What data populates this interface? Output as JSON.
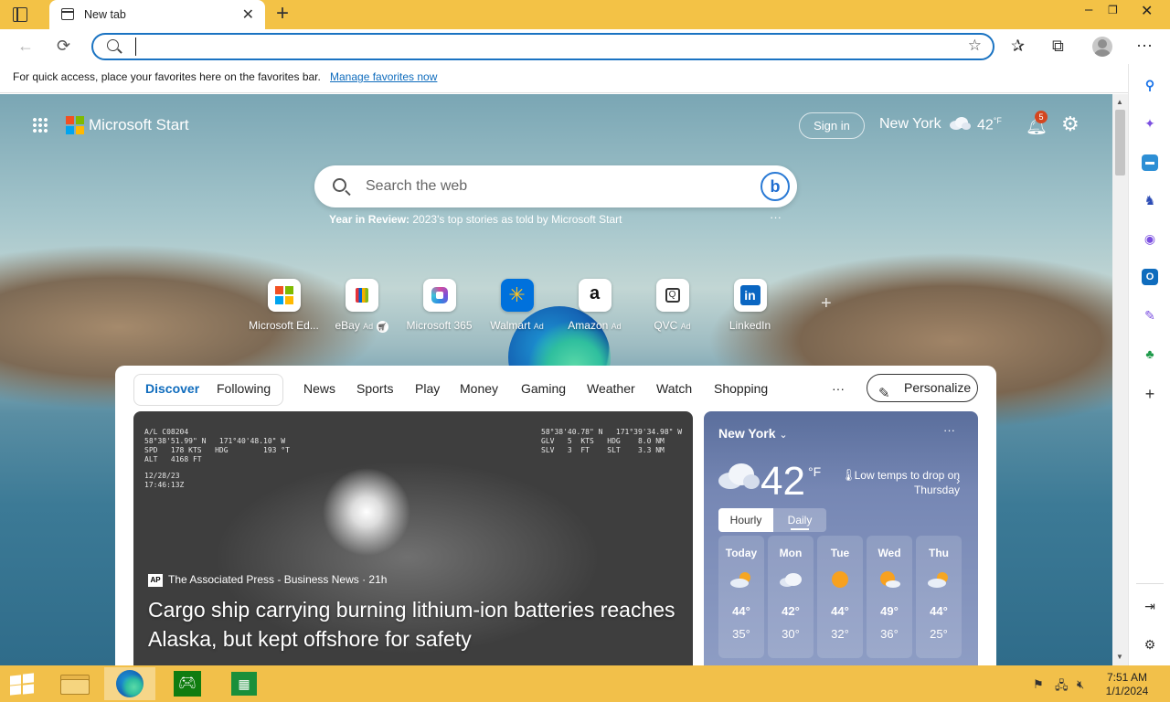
{
  "browser": {
    "tab_title": "New tab",
    "tab_close_icon": "close-icon",
    "new_tab_icon": "plus-icon",
    "window_controls": [
      "minimize-icon",
      "restore-icon",
      "close-icon"
    ],
    "address": {
      "value": "",
      "placeholder": ""
    },
    "toolbar_icons": [
      "back-icon",
      "refresh-icon",
      "add-favorite-icon",
      "favorites-icon",
      "collections-icon",
      "profile-avatar",
      "more-icon"
    ],
    "favorites_bar": {
      "message": "For quick access, place your favorites here on the favorites bar.",
      "link": "Manage favorites now"
    }
  },
  "header": {
    "brand": "Microsoft Start",
    "signin": "Sign in",
    "city": "New York",
    "temp": "42",
    "temp_unit": "°F",
    "notification_count": "5"
  },
  "search": {
    "placeholder": "Search the web",
    "promo_bold": "Year in Review:",
    "promo_text": " 2023's top stories as told by Microsoft Start",
    "more": "···"
  },
  "quick_links": [
    {
      "label": "Microsoft Ed...",
      "ad": ""
    },
    {
      "label": "eBay",
      "ad": "Ad"
    },
    {
      "label": "Microsoft 365",
      "ad": ""
    },
    {
      "label": "Walmart",
      "ad": "Ad"
    },
    {
      "label": "Amazon",
      "ad": "Ad"
    },
    {
      "label": "QVC",
      "ad": "Ad"
    },
    {
      "label": "LinkedIn",
      "ad": ""
    }
  ],
  "feed": {
    "tabs": [
      "Discover",
      "Following"
    ],
    "nav": [
      "News",
      "Sports",
      "Play",
      "Money",
      "Gaming",
      "Weather",
      "Watch",
      "Shopping"
    ],
    "nav_more": "···",
    "personalize": "Personalize",
    "hero": {
      "source": "The Associated Press - Business News · 21h",
      "title": "Cargo ship carrying burning lithium-ion batteries reaches Alaska, but kept offshore for safety",
      "hud_left": "A/L C08204\n58°38'51.99\" N   171°40'48.10\" W\nSPD   178 KTS   HDG        193 °T\nALT   4168 FT",
      "hud_right": "58°38'40.78\" N   171°39'34.98\" W\nGLV   5  KTS   HDG    8.0 NM\nSLV   3  FT    SLT    3.3 NM",
      "hud_date": "12/28/23\n17:46:13Z"
    }
  },
  "weather": {
    "city": "New York",
    "more": "···",
    "temp": "42",
    "unit": "°F",
    "alert": "Low temps to drop on Thursday",
    "toggle": [
      "Hourly",
      "Daily"
    ],
    "days": [
      {
        "name": "Today",
        "hi": "44°",
        "lo": "35°",
        "icon": "partly-cloudy-icon"
      },
      {
        "name": "Mon",
        "hi": "42°",
        "lo": "30°",
        "icon": "cloudy-icon"
      },
      {
        "name": "Tue",
        "hi": "44°",
        "lo": "32°",
        "icon": "sunny-icon"
      },
      {
        "name": "Wed",
        "hi": "49°",
        "lo": "36°",
        "icon": "partly-sunny-icon"
      },
      {
        "name": "Thu",
        "hi": "44°",
        "lo": "25°",
        "icon": "partly-cloudy-icon"
      }
    ]
  },
  "taskbar": {
    "time": "7:51 AM",
    "date": "1/1/2024"
  }
}
